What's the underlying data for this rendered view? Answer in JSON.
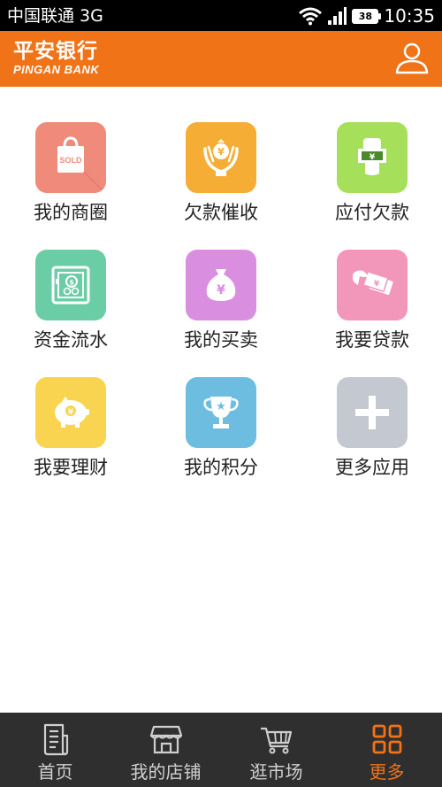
{
  "status_bar": {
    "carrier": "中国联通 3G",
    "battery": "38",
    "time": "10:35"
  },
  "header": {
    "bank_name_cn": "平安银行",
    "bank_name_en": "PINGAN BANK",
    "user_icon": "user-icon"
  },
  "grid": [
    {
      "label": "我的商圈",
      "icon": "shopping-bag-icon",
      "badge": "SOLD",
      "color": "#f08a7a"
    },
    {
      "label": "欠款催收",
      "icon": "money-bag-hands-icon",
      "badge": "¥",
      "color": "#f5ad35"
    },
    {
      "label": "应付欠款",
      "icon": "hand-cash-icon",
      "badge": "¥",
      "color": "#a6e05b"
    },
    {
      "label": "资金流水",
      "icon": "safe-icon",
      "badge": "$",
      "color": "#6bcda6"
    },
    {
      "label": "我的买卖",
      "icon": "money-sack-icon",
      "badge": "¥",
      "color": "#d98ee0"
    },
    {
      "label": "我要贷款",
      "icon": "hand-banknotes-icon",
      "badge": "¥",
      "color": "#f296ba"
    },
    {
      "label": "我要理财",
      "icon": "piggy-bank-icon",
      "badge": "¥",
      "color": "#f9d450"
    },
    {
      "label": "我的积分",
      "icon": "trophy-icon",
      "badge": "★",
      "color": "#6dbde0"
    },
    {
      "label": "更多应用",
      "icon": "plus-icon",
      "badge": "+",
      "color": "#c3c8d1"
    }
  ],
  "bottom_nav": [
    {
      "label": "首页",
      "icon": "document-icon",
      "active": false
    },
    {
      "label": "我的店铺",
      "icon": "store-icon",
      "active": false
    },
    {
      "label": "逛市场",
      "icon": "shopping-cart-icon",
      "active": false
    },
    {
      "label": "更多",
      "icon": "grid-icon",
      "active": true
    }
  ],
  "colors": {
    "brand": "#f07318",
    "nav_bg": "#2f2f2f",
    "nav_text": "#d0d0d0"
  }
}
